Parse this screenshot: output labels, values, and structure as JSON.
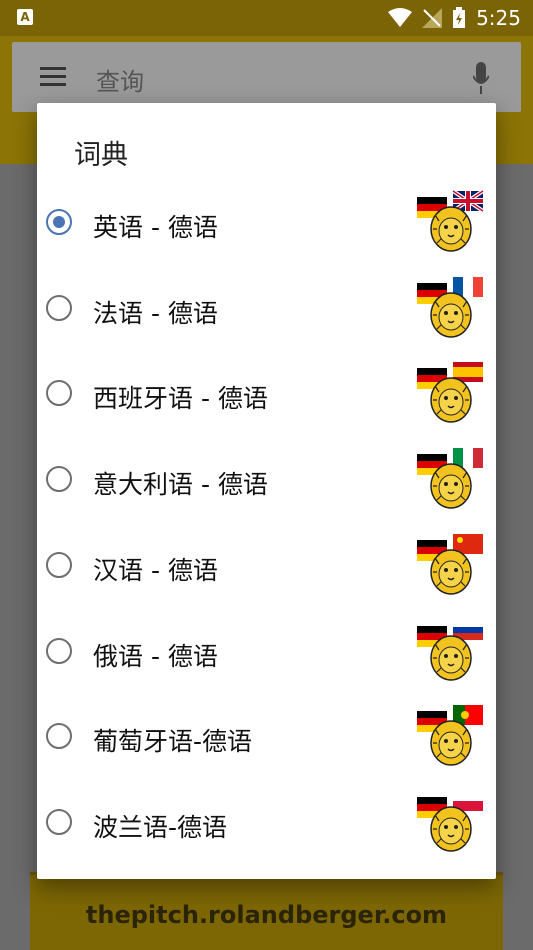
{
  "status": {
    "time": "5:25",
    "left_icon_letter": "A"
  },
  "search": {
    "placeholder": "查询"
  },
  "dialog": {
    "title": "词典",
    "items": [
      {
        "label": "英语 - 德语",
        "selected": true,
        "flag": "uk"
      },
      {
        "label": "法语 - 德语",
        "selected": false,
        "flag": "france"
      },
      {
        "label": "西班牙语 - 德语",
        "selected": false,
        "flag": "spain"
      },
      {
        "label": "意大利语 - 德语",
        "selected": false,
        "flag": "italy"
      },
      {
        "label": "汉语 - 德语",
        "selected": false,
        "flag": "china"
      },
      {
        "label": "俄语 - 德语",
        "selected": false,
        "flag": "russia"
      },
      {
        "label": "葡萄牙语-德语",
        "selected": false,
        "flag": "portugal"
      },
      {
        "label": "波兰语-德语",
        "selected": false,
        "flag": "poland"
      }
    ]
  },
  "banner": {
    "text": "thepitch.rolandberger.com"
  },
  "colors": {
    "accent": "#4a74b4",
    "appbar": "#8c7406",
    "statusbar": "#7a6405"
  }
}
